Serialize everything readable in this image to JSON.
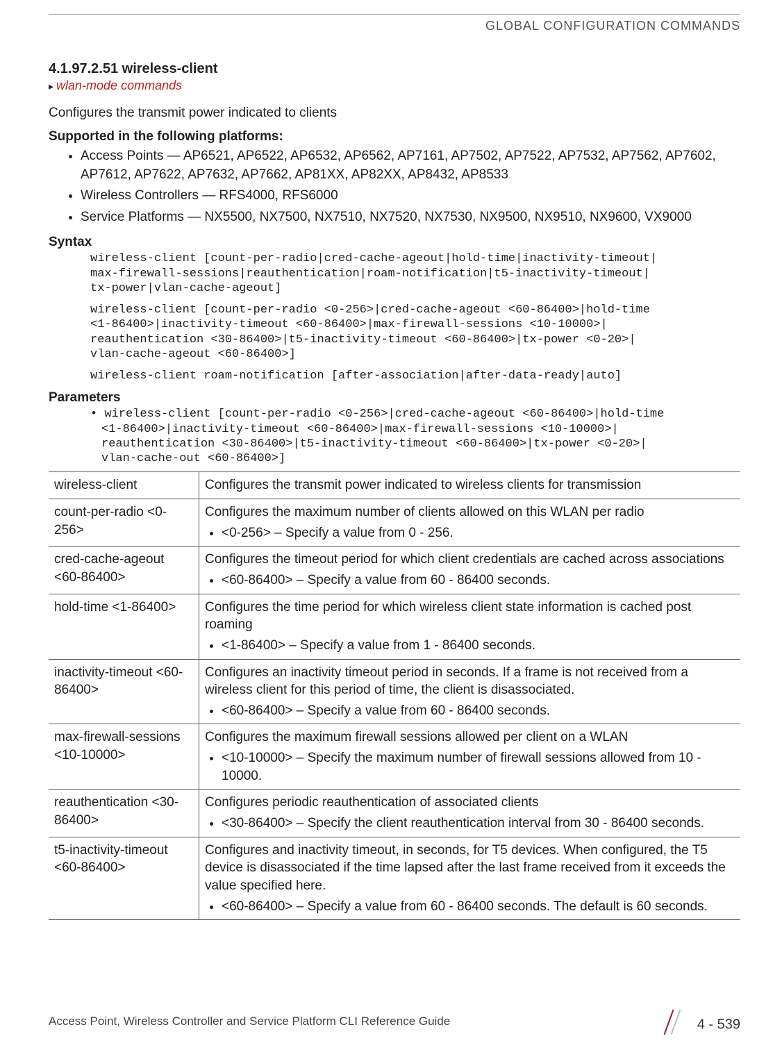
{
  "header": {
    "right": "GLOBAL CONFIGURATION COMMANDS"
  },
  "section": {
    "title": "4.1.97.2.51 wireless-client",
    "link": "wlan-mode commands"
  },
  "intro": "Configures the transmit power indicated to clients",
  "supported_heading": "Supported in the following platforms:",
  "platforms": [
    "Access Points — AP6521, AP6522, AP6532, AP6562, AP7161, AP7502, AP7522, AP7532, AP7562, AP7602, AP7612, AP7622, AP7632, AP7662, AP81XX, AP82XX, AP8432, AP8533",
    "Wireless Controllers — RFS4000, RFS6000",
    "Service Platforms — NX5500, NX7500, NX7510, NX7520, NX7530, NX9500, NX9510, NX9600, VX9000"
  ],
  "syntax_heading": "Syntax",
  "syntax_blocks": [
    "wireless-client [count-per-radio|cred-cache-ageout|hold-time|inactivity-timeout|\nmax-firewall-sessions|reauthentication|roam-notification|t5-inactivity-timeout|\ntx-power|vlan-cache-ageout]",
    "wireless-client [count-per-radio <0-256>|cred-cache-ageout <60-86400>|hold-time \n<1-86400>|inactivity-timeout <60-86400>|max-firewall-sessions <10-10000>|\nreauthentication <30-86400>|t5-inactivity-timeout <60-86400>|tx-power <0-20>|\nvlan-cache-ageout <60-86400>]",
    "wireless-client roam-notification [after-association|after-data-ready|auto]"
  ],
  "parameters_heading": "Parameters",
  "param_cmd": "• wireless-client [count-per-radio <0-256>|cred-cache-ageout <60-86400>|hold-time \n<1-86400>|inactivity-timeout <60-86400>|max-firewall-sessions <10-10000>|\nreauthentication <30-86400>|t5-inactivity-timeout <60-86400>|tx-power <0-20>|\nvlan-cache-out <60-86400>]",
  "table": [
    {
      "k": "wireless-client",
      "d": "Configures the transmit power indicated to wireless clients for transmission",
      "b": []
    },
    {
      "k": "count-per-radio <0-256>",
      "d": "Configures the maximum number of clients allowed on this WLAN per radio",
      "b": [
        "<0-256> – Specify a value from 0 - 256."
      ]
    },
    {
      "k": "cred-cache-ageout <60-86400>",
      "d": "Configures the timeout period for which client credentials are cached across associations",
      "b": [
        "<60-86400> – Specify a value from 60 - 86400 seconds."
      ]
    },
    {
      "k": "hold-time <1-86400>",
      "d": "Configures the time period for which wireless client state information is cached post roaming",
      "b": [
        "<1-86400> – Specify a value from 1 - 86400 seconds."
      ]
    },
    {
      "k": "inactivity-timeout <60-86400>",
      "d": "Configures an inactivity timeout period in seconds. If a frame is not received from a wireless client for this period of time, the client is disassociated.",
      "b": [
        "<60-86400> – Specify a value from 60 - 86400 seconds."
      ]
    },
    {
      "k": "max-firewall-sessions <10-10000>",
      "d": "Configures the maximum firewall sessions allowed per client on a WLAN",
      "b": [
        "<10-10000> – Specify the maximum number of firewall sessions allowed from 10 - 10000."
      ]
    },
    {
      "k": "reauthentication <30-86400>",
      "d": "Configures periodic reauthentication of associated clients",
      "b": [
        "<30-86400> – Specify the client reauthentication interval from 30 - 86400 seconds."
      ]
    },
    {
      "k": "t5-inactivity-timeout <60-86400>",
      "d": "Configures and inactivity timeout, in seconds, for T5 devices. When configured, the T5 device is disassociated if the time lapsed after the last frame received from it exceeds the value specified here.",
      "b": [
        "<60-86400> – Specify a value from 60 - 86400 seconds. The default is 60 seconds."
      ]
    }
  ],
  "footer": {
    "title": "Access Point, Wireless Controller and Service Platform CLI Reference Guide",
    "page": "4 - 539"
  }
}
